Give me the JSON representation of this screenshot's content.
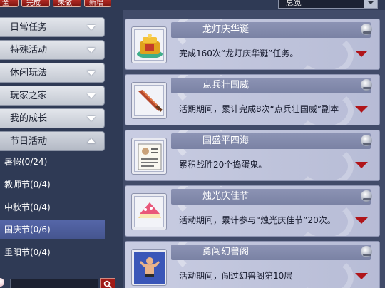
{
  "top_tabs": [
    {
      "label": "全部"
    },
    {
      "label": "完成"
    },
    {
      "label": "未做"
    },
    {
      "label": "新增"
    }
  ],
  "filter": {
    "selected": "总览"
  },
  "sidebar": {
    "categories": [
      {
        "label": "日常任务",
        "state": "collapsed"
      },
      {
        "label": "特殊活动",
        "state": "collapsed"
      },
      {
        "label": "休闲玩法",
        "state": "collapsed"
      },
      {
        "label": "玩家之家",
        "state": "collapsed"
      },
      {
        "label": "我的成长",
        "state": "collapsed"
      },
      {
        "label": "节日活动",
        "state": "expanded"
      }
    ],
    "sub_items": [
      {
        "label": "暑假(0/24)",
        "active": false
      },
      {
        "label": "教师节(0/4)",
        "active": false
      },
      {
        "label": "中秋节(0/4)",
        "active": false
      },
      {
        "label": "国庆节(0/6)",
        "active": true
      },
      {
        "label": "重阳节(0/4)",
        "active": false
      }
    ],
    "search": {
      "value": "",
      "icon": "search-icon"
    }
  },
  "cards": [
    {
      "title": "龙灯庆华诞",
      "desc": "完成160次“龙灯庆华诞”任务。",
      "icon": "dragon-lantern-icon"
    },
    {
      "title": "点兵壮国威",
      "desc": "活期期间，累计完成8次“点兵壮国威”副本",
      "icon": "sword-icon"
    },
    {
      "title": "国盛平四海",
      "desc": "累积战胜20个捣蛋鬼。",
      "icon": "wanted-poster-icon"
    },
    {
      "title": "烛光庆佳节",
      "desc": "活动期间，累计参与“烛光庆佳节”20次。",
      "icon": "cake-icon"
    },
    {
      "title": "勇闯幻兽阁",
      "desc": "活动期间，闯过幻兽阁第10层",
      "icon": "strongman-icon"
    }
  ],
  "colors": {
    "accent_red": "#b0151a",
    "active_item": "#4a5a98",
    "card_bg": "#c2c6de"
  }
}
